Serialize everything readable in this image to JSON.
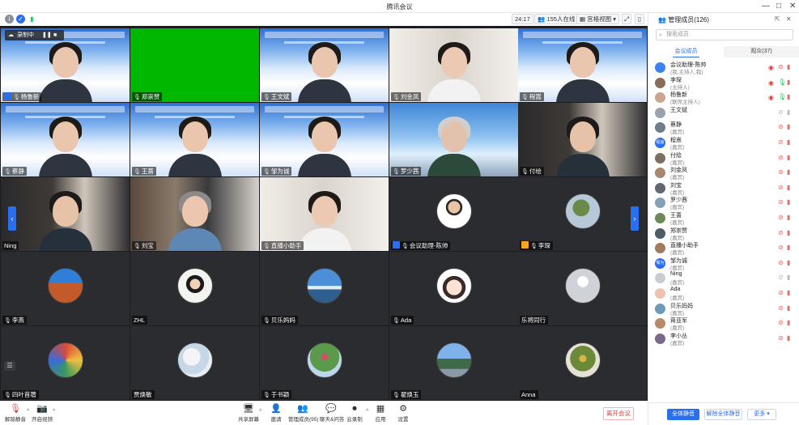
{
  "window": {
    "title": "腾讯会议",
    "controls": [
      "—",
      "□",
      "✕"
    ]
  },
  "toolbar": {
    "timer": "24:17",
    "participants_count": "155人在线",
    "view_mode": "宫格视图",
    "recording_label": "录制中"
  },
  "tiles": [
    {
      "label": "杨鲁新",
      "kind": "banner",
      "badge": "host",
      "speaking": false
    },
    {
      "label": "郑崇赞",
      "kind": "green"
    },
    {
      "label": "王文斌",
      "kind": "banner"
    },
    {
      "label": "刘金凤",
      "kind": "room-light",
      "speaking": true
    },
    {
      "label": "程嵩",
      "kind": "banner"
    },
    {
      "label": "蔡静",
      "kind": "banner"
    },
    {
      "label": "王蔷",
      "kind": "banner"
    },
    {
      "label": "邹为诚",
      "kind": "banner"
    },
    {
      "label": "罗少茜",
      "kind": "sky"
    },
    {
      "label": "付绘",
      "kind": "room-dark"
    },
    {
      "label": "Ning",
      "kind": "room-dark",
      "nomic": true
    },
    {
      "label": "刘宝",
      "kind": "room-shelf"
    },
    {
      "label": "直播小助手",
      "kind": "room-light"
    },
    {
      "label": "会议助理-陈帅",
      "kind": "avatar",
      "badge": "host",
      "avatar": "man"
    },
    {
      "label": "李琛",
      "kind": "avatar",
      "badge": "cohost",
      "avatar": "tree"
    },
    {
      "label": "李燕",
      "kind": "avatar",
      "avatar": "rock"
    },
    {
      "label": "ZHL",
      "kind": "avatar",
      "avatar": "kid",
      "nomic": true
    },
    {
      "label": "贝乐妈妈",
      "kind": "avatar",
      "avatar": "sea"
    },
    {
      "label": "Ada",
      "kind": "avatar",
      "avatar": "cartoon"
    },
    {
      "label": "乐将同行",
      "kind": "avatar",
      "avatar": "default",
      "nomic": true
    },
    {
      "label": "四叶苜蓿",
      "kind": "avatar",
      "avatar": "art"
    },
    {
      "label": "贾焕敏",
      "kind": "avatar",
      "avatar": "swirl",
      "nomic": true
    },
    {
      "label": "于书颖",
      "kind": "avatar",
      "avatar": "garden"
    },
    {
      "label": "翟焕玉",
      "kind": "avatar",
      "avatar": "landscape"
    },
    {
      "label": "Anna",
      "kind": "avatar",
      "avatar": "plant",
      "nomic": true
    }
  ],
  "bottombar": {
    "items": [
      {
        "label": "解除静音",
        "icon": "🎙"
      },
      {
        "label": "开启视频",
        "icon": "📷"
      },
      {
        "label": "共享屏幕",
        "icon": "🖥"
      },
      {
        "label": "邀请",
        "icon": "👤"
      },
      {
        "label": "管理成员(95)",
        "icon": "👥"
      },
      {
        "label": "聊天&问答",
        "icon": "💬"
      },
      {
        "label": "云录制",
        "icon": "⏺"
      },
      {
        "label": "应用",
        "icon": "▦"
      },
      {
        "label": "设置",
        "icon": "⚙"
      }
    ],
    "leave": "离开会议"
  },
  "panel": {
    "title": "管理成员(126)",
    "search_placeholder": "搜索成员",
    "tabs": [
      "会议成员",
      "观众(37)"
    ],
    "members": [
      {
        "name": "会议助理-陈帅",
        "role": "(我,主持人,我)",
        "av": "#3b82f6",
        "mic": "muted",
        "eye": true
      },
      {
        "name": "李琛",
        "role": "(主持人)",
        "av": "#8a6b5a",
        "mic": "live",
        "eye": true
      },
      {
        "name": "杨鲁新",
        "role": "(联席主持人)",
        "av": "#caa58f",
        "mic": "live",
        "eye": true
      },
      {
        "name": "王文斌",
        "role": "",
        "av": "#9aa3ad",
        "mic": "off",
        "eye": false
      },
      {
        "name": "蔡静",
        "role": "(嘉宾)",
        "av": "#6e7d8f",
        "mic": "muted",
        "eye": false
      },
      {
        "name": "程嵩",
        "role": "(嘉宾)",
        "av": "#2a6ff0",
        "mic": "muted",
        "eye": false,
        "short": "程嵩"
      },
      {
        "name": "付绘",
        "role": "(嘉宾)",
        "av": "#7e6e60",
        "mic": "muted",
        "eye": false
      },
      {
        "name": "刘金凤",
        "role": "(嘉宾)",
        "av": "#a5886f",
        "mic": "muted",
        "eye": false
      },
      {
        "name": "刘宝",
        "role": "(嘉宾)",
        "av": "#5f6770",
        "mic": "muted",
        "eye": false
      },
      {
        "name": "罗少茜",
        "role": "(嘉宾)",
        "av": "#85a0b8",
        "mic": "muted",
        "eye": false
      },
      {
        "name": "王蔷",
        "role": "(嘉宾)",
        "av": "#6d8a5a",
        "mic": "muted",
        "eye": false
      },
      {
        "name": "郑崇赞",
        "role": "(嘉宾)",
        "av": "#4e5a66",
        "mic": "muted",
        "eye": false
      },
      {
        "name": "直播小助手",
        "role": "(嘉宾)",
        "av": "#a37a60",
        "mic": "muted",
        "eye": false
      },
      {
        "name": "邹为诚",
        "role": "(嘉宾)",
        "av": "#2a6ff0",
        "mic": "muted",
        "eye": false,
        "short": "邹为"
      },
      {
        "name": "Ning",
        "role": "(嘉宾)",
        "av": "#c9cdd3",
        "mic": "off",
        "eye": false
      },
      {
        "name": "Ada",
        "role": "(嘉宾)",
        "av": "#f0c0b0",
        "mic": "muted",
        "eye": false
      },
      {
        "name": "贝乐妈妈",
        "role": "(嘉宾)",
        "av": "#6d9ab8",
        "mic": "muted",
        "eye": false
      },
      {
        "name": "蒋亚军",
        "role": "(嘉宾)",
        "av": "#b88a6a",
        "mic": "muted",
        "eye": false
      },
      {
        "name": "李小丛",
        "role": "(嘉宾)",
        "av": "#7a6a8a",
        "mic": "muted",
        "eye": false
      }
    ],
    "footer": {
      "mute_all": "全体静音",
      "unmute_all": "解除全体静音",
      "more": "更多"
    }
  }
}
